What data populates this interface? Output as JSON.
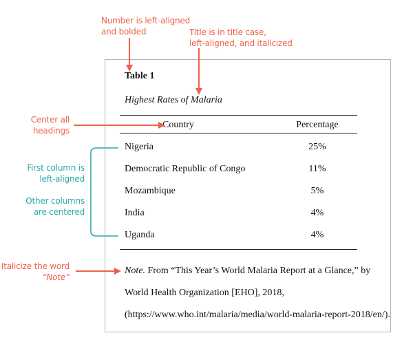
{
  "annotations": {
    "number_note": [
      "Number is left-aligned",
      "and bolded"
    ],
    "title_note": [
      "Title is in title case,",
      "left-aligned, and italicized"
    ],
    "headings_note": [
      "Center all",
      "headings"
    ],
    "first_col_note": [
      "First column is",
      "left-aligned"
    ],
    "other_cols_note": [
      "Other columns",
      "are centered"
    ],
    "note_note": [
      "Italicize the word",
      "“Note”"
    ]
  },
  "colors": {
    "annotation_red": "#f0604a",
    "annotation_teal": "#2aa8a8"
  },
  "table": {
    "number": "Table 1",
    "title": "Highest Rates of Malaria",
    "headers": [
      "Country",
      "Percentage"
    ],
    "rows": [
      {
        "country": "Nigeria",
        "percentage": "25%"
      },
      {
        "country": "Democratic Republic of Congo",
        "percentage": "11%"
      },
      {
        "country": "Mozambique",
        "percentage": "5%"
      },
      {
        "country": "India",
        "percentage": "4%"
      },
      {
        "country": "Uganda",
        "percentage": "4%"
      }
    ],
    "note": {
      "label": "Note.",
      "line1": " From “This Year’s World Malaria Report at a Glance,” by",
      "line2": "World Health Organization [EHO], 2018,",
      "line3": "(https://www.who.int/malaria/media/world-malaria-report-2018/en/)."
    }
  }
}
